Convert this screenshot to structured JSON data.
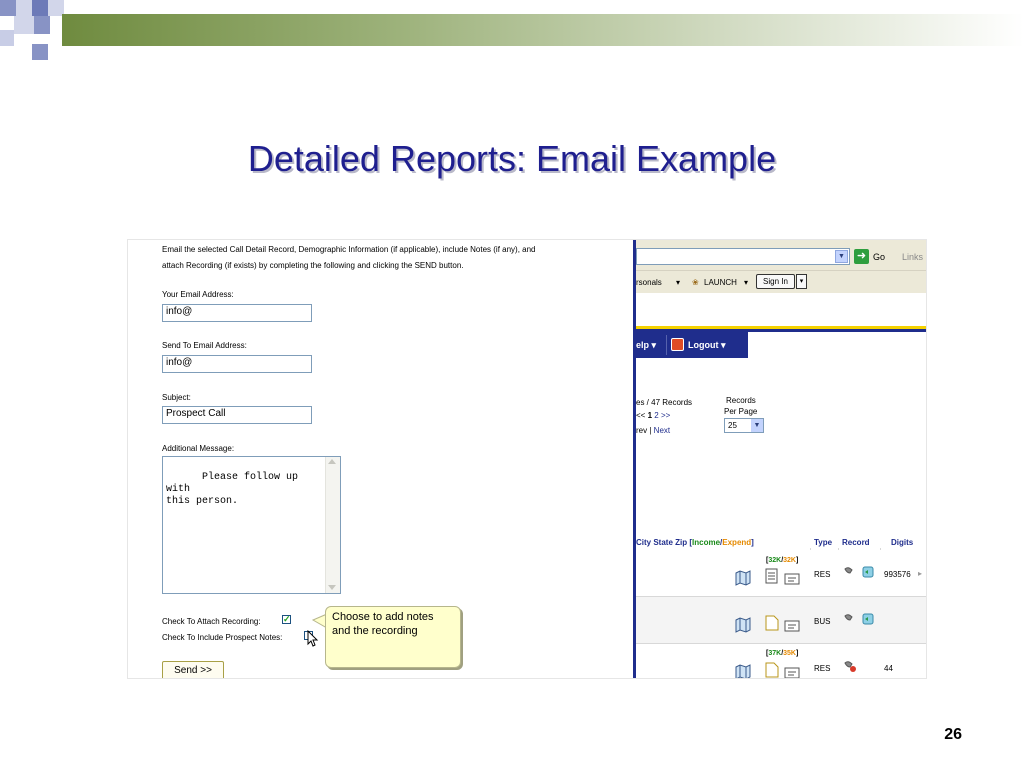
{
  "slide": {
    "title": "Detailed Reports:  Email Example",
    "page_number": "26"
  },
  "email_form": {
    "instructions_line1": "Email the selected Call Detail Record, Demographic Information (if applicable), include Notes (if any), and",
    "instructions_line2": "attach Recording (if exists) by completing the following and clicking the SEND button.",
    "your_email_label": "Your Email Address:",
    "your_email_value": "info@",
    "send_to_label": "Send To Email Address:",
    "send_to_value": "info@",
    "subject_label": "Subject:",
    "subject_value": "Prospect Call",
    "message_label": "Additional Message:",
    "message_value": "Please follow up with\nthis person.",
    "attach_recording_label": "Check To Attach Recording:",
    "include_notes_label": "Check To Include Prospect Notes:",
    "send_label": "Send >>",
    "tooltip_text": "Choose to add notes and the recording",
    "checkmark": "✓"
  },
  "browser": {
    "go_label": "Go",
    "links_label": "Links",
    "toolbar_personals": "rsonals",
    "toolbar_launch": "LAUNCH",
    "sign_in_label": "Sign In",
    "nav_help": "elp",
    "nav_logout": "Logout",
    "records_summary": "es / 47 Records",
    "pager_prev_arrows": "<<",
    "pager_page_current": "1",
    "pager_page_next": "2",
    "pager_next_arrows": ">>",
    "prev_label": "rev",
    "pager_separator": "|",
    "next_label": "Next",
    "records_per_page_label1": "Records",
    "records_per_page_label2": "Per Page",
    "records_per_page_value": "25",
    "table_headers": {
      "csz_prefix": "City State Zip [",
      "income": "Income",
      "slash": "/",
      "expend": "Expend",
      "csz_suffix": "]",
      "type": "Type",
      "record": "Record",
      "digits": "Digits"
    },
    "rows": [
      {
        "badge_income": "32K",
        "badge_expend": "32K",
        "type": "RES",
        "digits": "993576"
      },
      {
        "badge_income": "",
        "badge_expend": "",
        "type": "BUS",
        "digits": ""
      },
      {
        "badge_income": "37K",
        "badge_expend": "35K",
        "type": "RES",
        "digits": "44"
      }
    ]
  },
  "colors": {
    "title": "#1f1f8f",
    "navy": "#1f2d8c",
    "income": "#1a8a1a",
    "expend": "#e58a00",
    "tooltip_bg": "#ffffcc"
  }
}
